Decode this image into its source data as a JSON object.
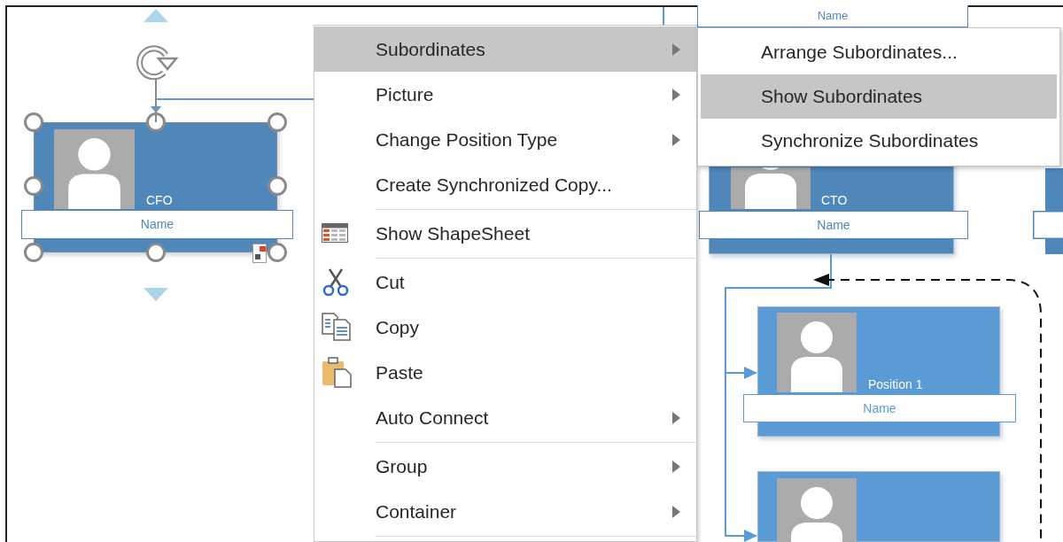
{
  "canvas": {
    "shapes": [
      {
        "title": "CFO",
        "name_label": "Name",
        "selected": true,
        "color": "#4f87bb"
      },
      {
        "name_label": "Name",
        "selected": false,
        "color": "#4f87bb"
      },
      {
        "title": "CTO",
        "name_label": "Name",
        "selected": false,
        "color": "#4f87bb"
      },
      {
        "selected": false,
        "color": "#4f87bb"
      },
      {
        "title": "Position 1",
        "name_label": "Name",
        "selected": false,
        "color": "#5b9bd5"
      },
      {
        "selected": false,
        "color": "#5b9bd5"
      }
    ]
  },
  "context_menu": {
    "groups": [
      [
        {
          "label": "Subordinates",
          "kind": "submenu",
          "selected": true
        },
        {
          "label": "Picture",
          "kind": "submenu",
          "selected": false
        },
        {
          "label": "Change Position Type",
          "kind": "submenu",
          "selected": false
        },
        {
          "label": "Create Synchronized Copy...",
          "kind": "command",
          "selected": false
        }
      ],
      [
        {
          "label": "Show ShapeSheet",
          "kind": "sheet",
          "selected": false
        }
      ],
      [
        {
          "label": "Cut",
          "kind": "cut",
          "selected": false
        },
        {
          "label": "Copy",
          "kind": "copy",
          "selected": false
        },
        {
          "label": "Paste",
          "kind": "paste",
          "selected": false
        },
        {
          "label": "Auto Connect",
          "kind": "submenu",
          "selected": false
        }
      ],
      [
        {
          "label": "Group",
          "kind": "submenu",
          "selected": false
        },
        {
          "label": "Container",
          "kind": "submenu",
          "selected": false
        }
      ]
    ]
  },
  "submenu": {
    "items": [
      {
        "label": "Arrange Subordinates...",
        "selected": false
      },
      {
        "label": "Show Subordinates",
        "selected": true
      },
      {
        "label": "Synchronize Subordinates",
        "selected": false
      }
    ]
  }
}
